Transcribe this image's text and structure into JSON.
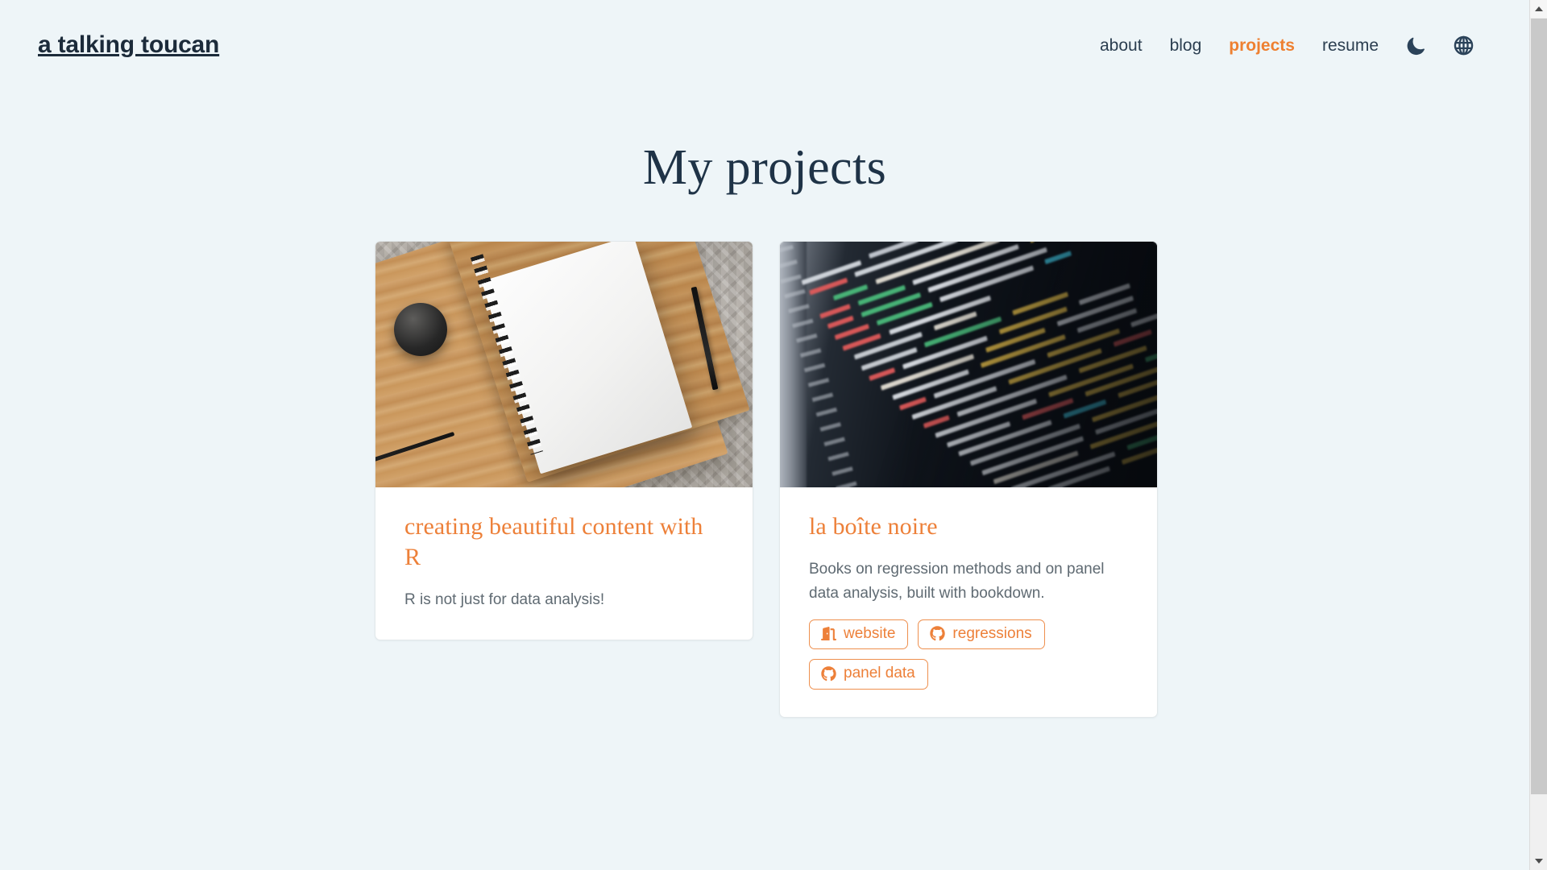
{
  "theme": {
    "background": "#eef5f8",
    "accent": "#ee8031",
    "title_color": "#1c2b3a",
    "card_background": "#ffffff",
    "body_text_color": "#5f6a72"
  },
  "header": {
    "site_title": "a talking toucan",
    "nav": [
      {
        "label": "about",
        "active": false
      },
      {
        "label": "blog",
        "active": false
      },
      {
        "label": "projects",
        "active": true
      },
      {
        "label": "resume",
        "active": false
      }
    ],
    "icons": [
      {
        "name": "moon-icon",
        "label": "dark mode toggle"
      },
      {
        "name": "globe-icon",
        "label": "language switcher"
      }
    ]
  },
  "main": {
    "page_title": "My projects",
    "cards": [
      {
        "title": "creating beautiful content with R",
        "description": "R is not just for data analysis!",
        "image_alt": "notebook, pen and coffee cup on a wooden board over a patterned rug",
        "tags": []
      },
      {
        "title": "la boîte noire",
        "description": "Books on regression methods and on panel data analysis, built with bookdown.",
        "image_alt": "computer monitor showing highlighted PHP and HTML source code",
        "tags": [
          {
            "label": "website",
            "icon": "door-open-icon"
          },
          {
            "label": "regressions",
            "icon": "github-icon"
          },
          {
            "label": "panel data",
            "icon": "github-icon"
          }
        ]
      }
    ]
  },
  "scrollbar": {
    "up_arrow": "scroll-up",
    "down_arrow": "scroll-down"
  }
}
